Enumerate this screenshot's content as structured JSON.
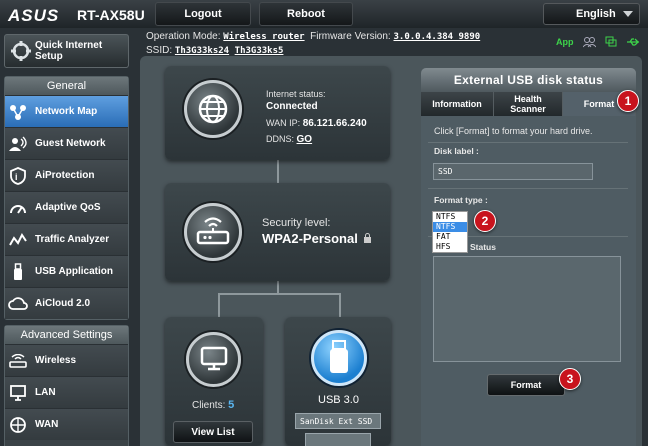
{
  "brand": {
    "logo": "ASUS",
    "model": "RT-AX58U"
  },
  "topbar": {
    "logout_label": "Logout",
    "reboot_label": "Reboot",
    "language": "English"
  },
  "info": {
    "opmode_label": "Operation Mode:",
    "opmode_value": "Wireless router",
    "fw_label": "Firmware Version:",
    "fw_value": "3.0.0.4.384_9890",
    "ssid_label": "SSID:",
    "ssid_1": "Th3G33ks24",
    "ssid_2": "Th3G33ks5",
    "app_label": "App"
  },
  "sidebar": {
    "quick_label": "Quick Internet Setup",
    "general_header": "General",
    "general_items": [
      {
        "label": "Network Map",
        "icon": "network-map-icon",
        "active": true
      },
      {
        "label": "Guest Network",
        "icon": "guest-network-icon"
      },
      {
        "label": "AiProtection",
        "icon": "aiprotection-icon"
      },
      {
        "label": "Adaptive QoS",
        "icon": "qos-icon"
      },
      {
        "label": "Traffic Analyzer",
        "icon": "traffic-analyzer-icon"
      },
      {
        "label": "USB Application",
        "icon": "usb-application-icon"
      },
      {
        "label": "AiCloud 2.0",
        "icon": "aicloud-icon"
      }
    ],
    "advanced_header": "Advanced Settings",
    "advanced_items": [
      {
        "label": "Wireless",
        "icon": "wireless-icon"
      },
      {
        "label": "LAN",
        "icon": "lan-icon"
      },
      {
        "label": "WAN",
        "icon": "wan-icon"
      }
    ]
  },
  "map": {
    "internet_status_label": "Internet status:",
    "internet_status_value": "Connected",
    "wan_ip_label": "WAN IP:",
    "wan_ip_value": "86.121.66.240",
    "ddns_label": "DDNS:",
    "ddns_value": "GO",
    "security_label": "Security level:",
    "security_value": "WPA2-Personal",
    "clients_label": "Clients:",
    "clients_value": "5",
    "view_list_label": "View List",
    "usb_label": "USB 3.0",
    "usb_device": "SanDisk Ext SSD"
  },
  "usb_panel": {
    "title": "External USB disk status",
    "tabs": [
      "Information",
      "Health Scanner",
      "Format"
    ],
    "selected_tab": "Format",
    "instruction": "Click [Format] to format your hard drive.",
    "disk_label_title": "Disk label :",
    "disk_label_value": "SSD",
    "format_type_title": "Format type :",
    "format_type_value": "NTFS",
    "format_options": [
      "NTFS",
      "FAT",
      "HFS"
    ],
    "highlighted_option": "NTFS",
    "status_title": "Status",
    "format_button": "Format"
  },
  "badges": [
    "1",
    "2",
    "3"
  ],
  "colors": {
    "accent_blue": "#3b8de6",
    "badge_red": "#c8131d",
    "app_green": "#3dd44a"
  }
}
